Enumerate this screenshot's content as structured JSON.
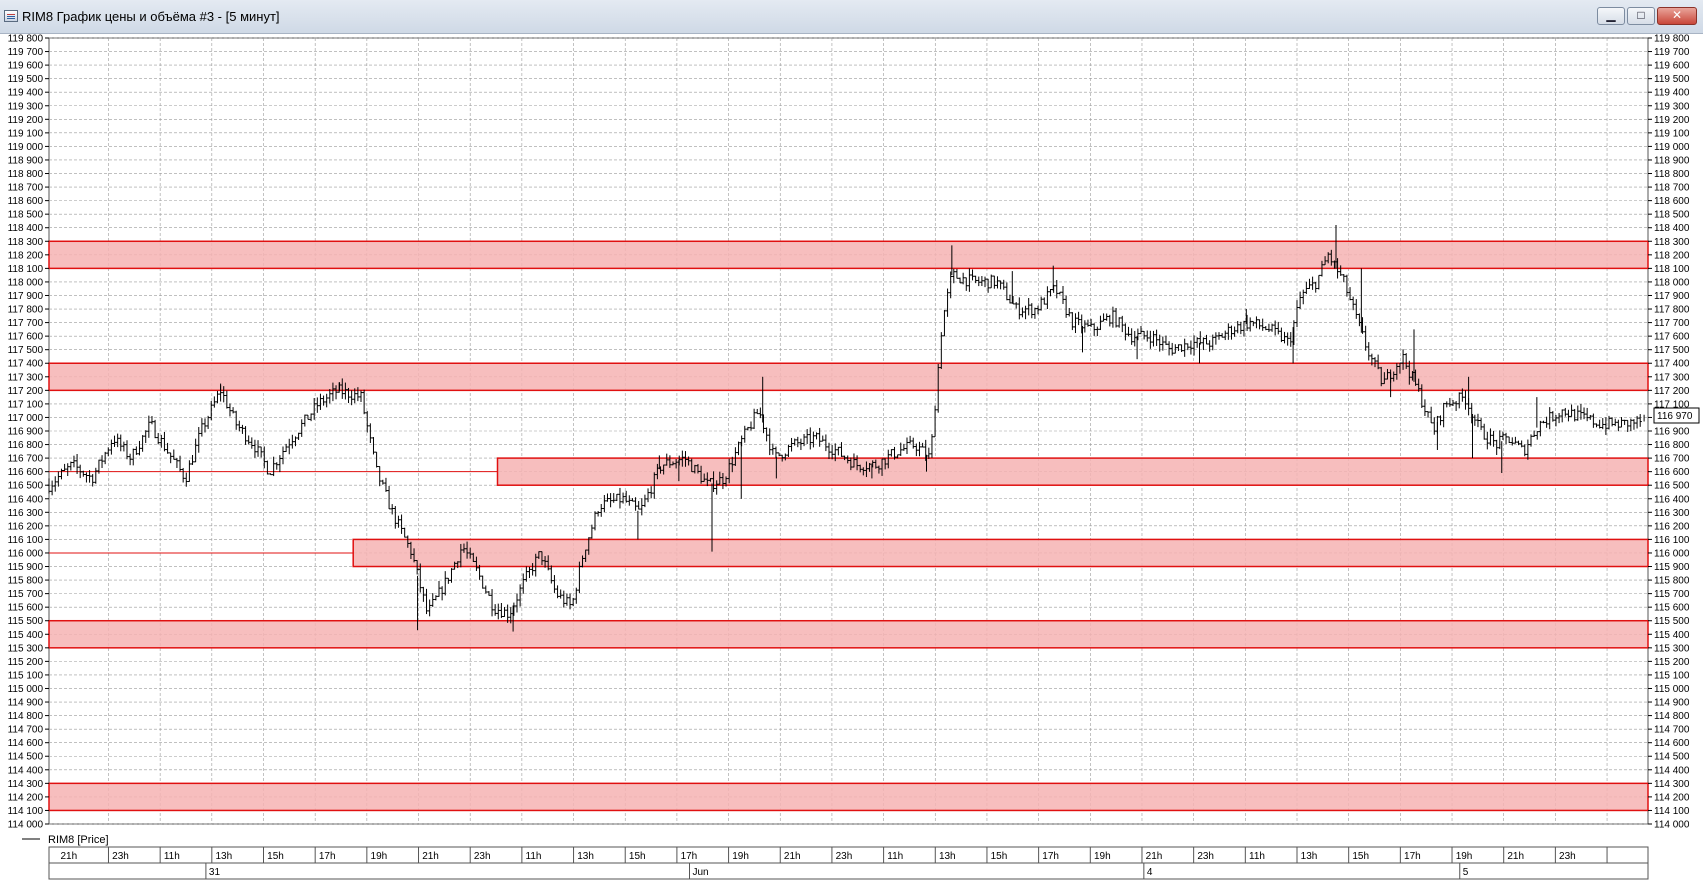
{
  "window": {
    "title": "RIM8 График цены и объёма #3 - [5 минут]",
    "minimize_glyph": "▁",
    "maximize_glyph": "□",
    "close_glyph": "✕"
  },
  "chart_data": {
    "type": "ohlc",
    "legend": "RIM8 [Price]",
    "last_price_label": "116 970",
    "y_range": [
      114000,
      119800
    ],
    "y_tick_step": 100,
    "grid": true,
    "colors": {
      "bars": "#000000",
      "zone_fill": "#f6b3b3",
      "zone_border": "#e01010",
      "grid": "#9a9a9a"
    },
    "time_labels": [
      "21h",
      "23h",
      "11h",
      "13h",
      "15h",
      "17h",
      "19h",
      "21h",
      "23h",
      "11h",
      "13h",
      "15h",
      "17h",
      "19h",
      "21h",
      "23h",
      "11h",
      "13h",
      "15h",
      "17h",
      "19h",
      "21h",
      "23h",
      "11h",
      "13h",
      "15h",
      "17h",
      "19h",
      "21h",
      "23h"
    ],
    "date_labels": [
      "31",
      "Jun",
      "4",
      "5"
    ],
    "zones": [
      {
        "low": 118100,
        "high": 118300
      },
      {
        "low": 117200,
        "high": 117400
      },
      {
        "low": 116500,
        "high": 116700
      },
      {
        "low": 115900,
        "high": 116100
      },
      {
        "low": 115300,
        "high": 115500
      },
      {
        "low": 114100,
        "high": 114300
      }
    ],
    "levels": [
      116600,
      116000
    ],
    "path": [
      {
        "t": 0,
        "p": 116500
      },
      {
        "t": 1.2,
        "p": 116650
      },
      {
        "t": 2.2,
        "p": 116550
      },
      {
        "t": 3.3,
        "p": 116850
      },
      {
        "t": 4.2,
        "p": 116700
      },
      {
        "t": 5.2,
        "p": 116950
      },
      {
        "t": 6.3,
        "p": 116700
      },
      {
        "t": 7,
        "p": 116550
      },
      {
        "t": 7.8,
        "p": 116900
      },
      {
        "t": 8.8,
        "p": 117200
      },
      {
        "t": 9.6,
        "p": 116950
      },
      {
        "t": 10.5,
        "p": 116800
      },
      {
        "t": 11.3,
        "p": 116600
      },
      {
        "t": 12.2,
        "p": 116800
      },
      {
        "t": 13,
        "p": 116950
      },
      {
        "t": 13.8,
        "p": 117100
      },
      {
        "t": 14.8,
        "p": 117200
      },
      {
        "t": 16,
        "p": 117150
      },
      {
        "t": 16.8,
        "p": 116600
      },
      {
        "t": 17.6,
        "p": 116300
      },
      {
        "t": 18.6,
        "p": 116000
      },
      {
        "t": 19.4,
        "p": 115550
      },
      {
        "t": 20.4,
        "p": 115800
      },
      {
        "t": 21.2,
        "p": 116050
      },
      {
        "t": 22,
        "p": 115850
      },
      {
        "t": 22.8,
        "p": 115600
      },
      {
        "t": 23.6,
        "p": 115550
      },
      {
        "t": 24.4,
        "p": 115800
      },
      {
        "t": 25.2,
        "p": 116000
      },
      {
        "t": 26,
        "p": 115700
      },
      {
        "t": 26.8,
        "p": 115600
      },
      {
        "t": 27.4,
        "p": 116000
      },
      {
        "t": 28.2,
        "p": 116350
      },
      {
        "t": 29.4,
        "p": 116400
      },
      {
        "t": 30.3,
        "p": 116300
      },
      {
        "t": 31.4,
        "p": 116650
      },
      {
        "t": 32.6,
        "p": 116700
      },
      {
        "t": 33.8,
        "p": 116500
      },
      {
        "t": 34.6,
        "p": 116550
      },
      {
        "t": 35.6,
        "p": 116850
      },
      {
        "t": 36.4,
        "p": 117050
      },
      {
        "t": 37.2,
        "p": 116700
      },
      {
        "t": 38.2,
        "p": 116800
      },
      {
        "t": 39.3,
        "p": 116850
      },
      {
        "t": 40.4,
        "p": 116750
      },
      {
        "t": 41.4,
        "p": 116650
      },
      {
        "t": 42.4,
        "p": 116650
      },
      {
        "t": 43.5,
        "p": 116750
      },
      {
        "t": 44.4,
        "p": 116800
      },
      {
        "t": 45.2,
        "p": 116700
      },
      {
        "t": 45.8,
        "p": 117700
      },
      {
        "t": 46.3,
        "p": 118050
      },
      {
        "t": 47.4,
        "p": 118000
      },
      {
        "t": 48.6,
        "p": 118000
      },
      {
        "t": 49.6,
        "p": 117800
      },
      {
        "t": 50.6,
        "p": 117800
      },
      {
        "t": 51.6,
        "p": 117950
      },
      {
        "t": 52.5,
        "p": 117700
      },
      {
        "t": 53.5,
        "p": 117650
      },
      {
        "t": 54.5,
        "p": 117750
      },
      {
        "t": 55.5,
        "p": 117600
      },
      {
        "t": 56.5,
        "p": 117600
      },
      {
        "t": 57.5,
        "p": 117500
      },
      {
        "t": 58.5,
        "p": 117550
      },
      {
        "t": 59.6,
        "p": 117550
      },
      {
        "t": 60.6,
        "p": 117650
      },
      {
        "t": 61.6,
        "p": 117700
      },
      {
        "t": 62.6,
        "p": 117650
      },
      {
        "t": 63.6,
        "p": 117550
      },
      {
        "t": 64.2,
        "p": 117900
      },
      {
        "t": 65,
        "p": 118000
      },
      {
        "t": 65.6,
        "p": 118200
      },
      {
        "t": 66.4,
        "p": 118000
      },
      {
        "t": 67,
        "p": 117750
      },
      {
        "t": 67.6,
        "p": 117500
      },
      {
        "t": 68.4,
        "p": 117250
      },
      {
        "t": 69.4,
        "p": 117450
      },
      {
        "t": 70.2,
        "p": 117200
      },
      {
        "t": 71,
        "p": 116900
      },
      {
        "t": 71.6,
        "p": 117100
      },
      {
        "t": 72.6,
        "p": 117150
      },
      {
        "t": 73.4,
        "p": 116900
      },
      {
        "t": 74.2,
        "p": 116800
      },
      {
        "t": 74.8,
        "p": 116850
      },
      {
        "t": 75.6,
        "p": 116750
      },
      {
        "t": 76.4,
        "p": 116950
      },
      {
        "t": 77.6,
        "p": 117050
      },
      {
        "t": 78.6,
        "p": 117000
      },
      {
        "t": 79.6,
        "p": 116950
      },
      {
        "t": 80.6,
        "p": 116950
      },
      {
        "t": 81.6,
        "p": 116970
      }
    ],
    "spikes": [
      {
        "t": 8.8,
        "p": 117250
      },
      {
        "t": 14.9,
        "p": 117260
      },
      {
        "t": 18.9,
        "p": 115430
      },
      {
        "t": 23.8,
        "p": 115420
      },
      {
        "t": 30.2,
        "p": 116100
      },
      {
        "t": 31.3,
        "p": 116720
      },
      {
        "t": 32.3,
        "p": 116530
      },
      {
        "t": 34.0,
        "p": 116010
      },
      {
        "t": 35.5,
        "p": 116400
      },
      {
        "t": 36.6,
        "p": 117300
      },
      {
        "t": 37.3,
        "p": 116550
      },
      {
        "t": 42.2,
        "p": 116550
      },
      {
        "t": 45.0,
        "p": 116600
      },
      {
        "t": 46.3,
        "p": 118270
      },
      {
        "t": 49.4,
        "p": 118080
      },
      {
        "t": 51.5,
        "p": 118120
      },
      {
        "t": 53.0,
        "p": 117480
      },
      {
        "t": 55.8,
        "p": 117430
      },
      {
        "t": 59.0,
        "p": 117400
      },
      {
        "t": 61.4,
        "p": 117800
      },
      {
        "t": 63.8,
        "p": 117400
      },
      {
        "t": 66.0,
        "p": 118420
      },
      {
        "t": 67.3,
        "p": 118100
      },
      {
        "t": 68.8,
        "p": 117150
      },
      {
        "t": 70.0,
        "p": 117650
      },
      {
        "t": 71.2,
        "p": 116760
      },
      {
        "t": 72.8,
        "p": 117300
      },
      {
        "t": 73.0,
        "p": 116700
      },
      {
        "t": 74.5,
        "p": 116590
      },
      {
        "t": 76.3,
        "p": 117150
      },
      {
        "t": 81.8,
        "p": 117020
      }
    ]
  }
}
